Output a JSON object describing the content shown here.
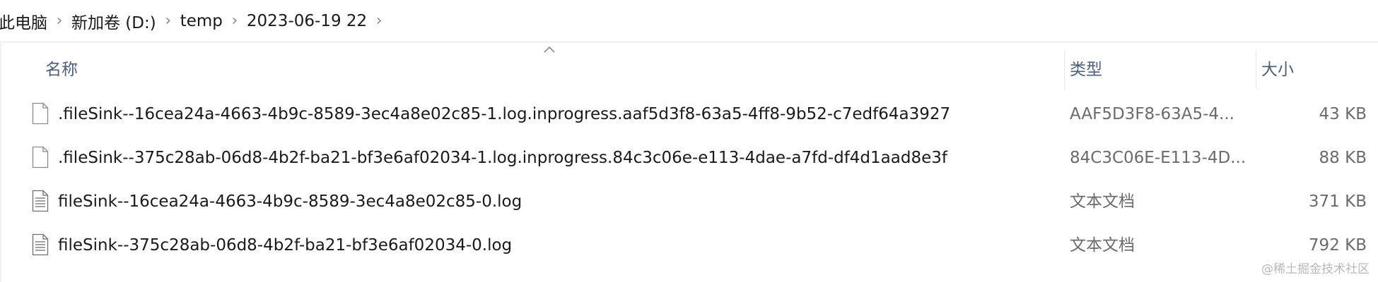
{
  "breadcrumb": {
    "items": [
      "此电脑",
      "新加卷 (D:)",
      "temp",
      "2023-06-19 22"
    ],
    "separator": "›"
  },
  "columns": {
    "name": "名称",
    "type": "类型",
    "size": "大小",
    "sorted_column": "name",
    "sort_direction": "ascending"
  },
  "files": [
    {
      "name": ".fileSink--16cea24a-4663-4b9c-8589-3ec4a8e02c85-1.log.inprogress.aaf5d3f8-63a5-4ff8-9b52-c7edf64a3927",
      "type": "AAF5D3F8-63A5-4...",
      "size": "43 KB",
      "icon": "blank-file-icon"
    },
    {
      "name": ".fileSink--375c28ab-06d8-4b2f-ba21-bf3e6af02034-1.log.inprogress.84c3c06e-e113-4dae-a7fd-df4d1aad8e3f",
      "type": "84C3C06E-E113-4D...",
      "size": "88 KB",
      "icon": "blank-file-icon"
    },
    {
      "name": "fileSink--16cea24a-4663-4b9c-8589-3ec4a8e02c85-0.log",
      "type": "文本文档",
      "size": "371 KB",
      "icon": "text-document-icon"
    },
    {
      "name": "fileSink--375c28ab-06d8-4b2f-ba21-bf3e6af02034-0.log",
      "type": "文本文档",
      "size": "792 KB",
      "icon": "text-document-icon"
    }
  ],
  "watermark": "@稀土掘金技术社区",
  "colors": {
    "header_text": "#4c607a",
    "secondary_text": "#6b6b6b",
    "separator": "#8a8a8a"
  }
}
